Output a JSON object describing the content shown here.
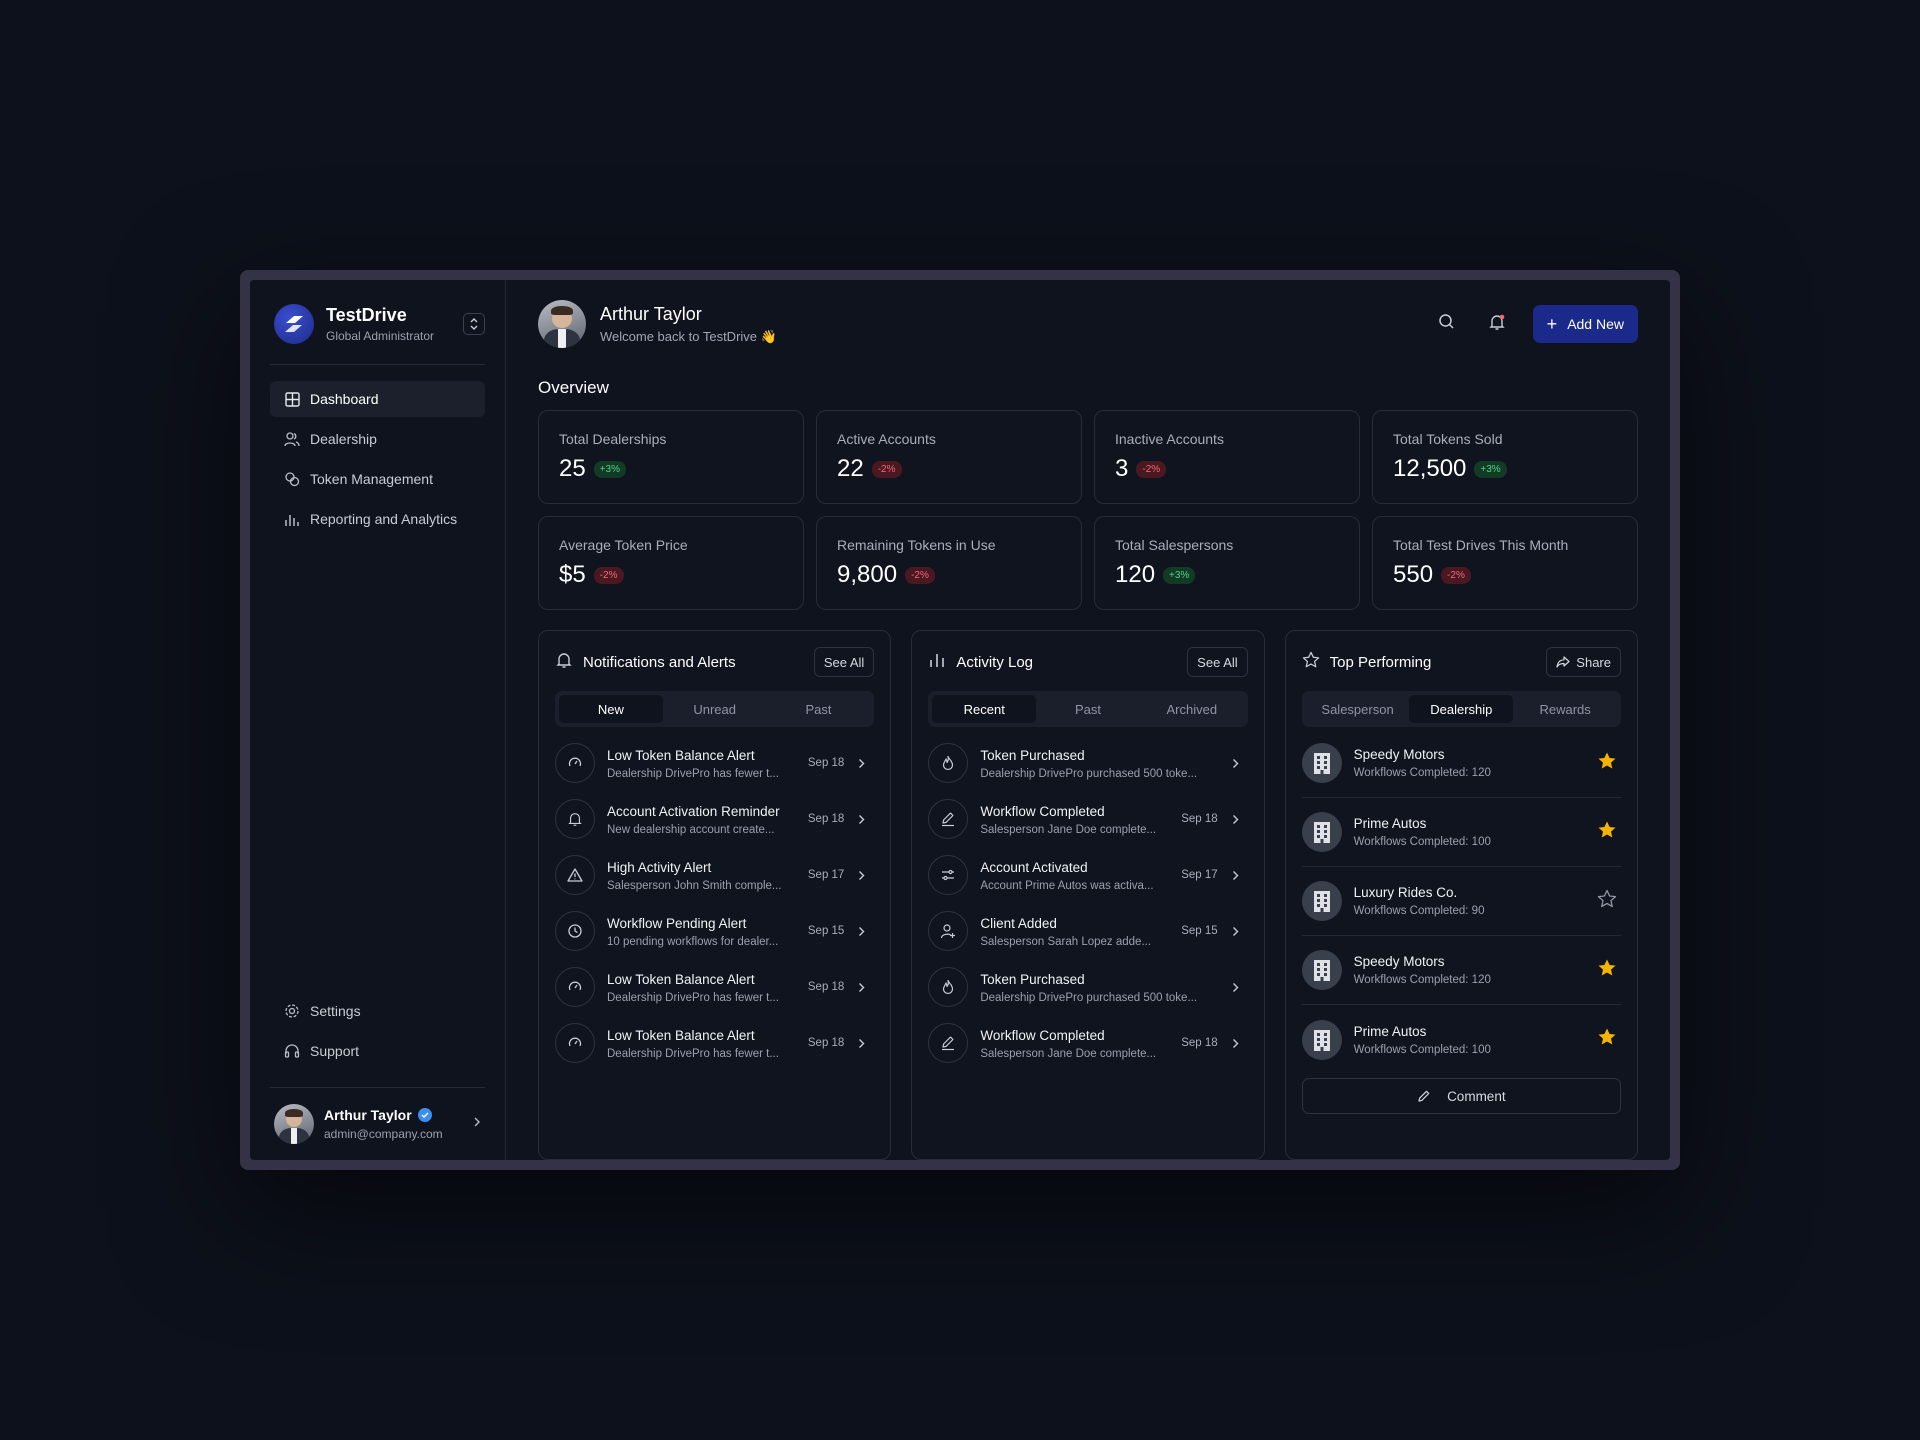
{
  "brand": {
    "name": "TestDrive",
    "role": "Global Administrator"
  },
  "nav": {
    "items": [
      {
        "label": "Dashboard",
        "icon": "grid-icon",
        "active": true
      },
      {
        "label": "Dealership",
        "icon": "users-icon"
      },
      {
        "label": "Token Management",
        "icon": "coins-icon"
      },
      {
        "label": "Reporting and Analytics",
        "icon": "bar-chart-icon"
      }
    ],
    "bottom": [
      {
        "label": "Settings",
        "icon": "gear-icon"
      },
      {
        "label": "Support",
        "icon": "headphones-icon"
      }
    ]
  },
  "user": {
    "name": "Arthur Taylor",
    "email": "admin@company.com"
  },
  "header": {
    "name": "Arthur Taylor",
    "welcome": "Welcome back to TestDrive 👋",
    "add_new": "Add New"
  },
  "overview": {
    "title": "Overview",
    "stats": [
      {
        "label": "Total Dealerships",
        "value": "25",
        "change": "+3%",
        "trend": "up"
      },
      {
        "label": "Active Accounts",
        "value": "22",
        "change": "-2%",
        "trend": "down"
      },
      {
        "label": "Inactive Accounts",
        "value": "3",
        "change": "-2%",
        "trend": "down"
      },
      {
        "label": "Total Tokens Sold",
        "value": "12,500",
        "change": "+3%",
        "trend": "up"
      },
      {
        "label": "Average Token Price",
        "value": "$5",
        "change": "-2%",
        "trend": "down"
      },
      {
        "label": "Remaining Tokens in Use",
        "value": "9,800",
        "change": "-2%",
        "trend": "down"
      },
      {
        "label": "Total Salespersons",
        "value": "120",
        "change": "+3%",
        "trend": "up"
      },
      {
        "label": "Total Test Drives This Month",
        "value": "550",
        "change": "-2%",
        "trend": "down"
      }
    ]
  },
  "notifications": {
    "title": "Notifications and Alerts",
    "see_all": "See All",
    "tabs": [
      "New",
      "Unread",
      "Past"
    ],
    "items": [
      {
        "icon": "gauge-icon",
        "title": "Low Token Balance Alert",
        "sub": "Dealership DrivePro has fewer t...",
        "date": "Sep 18"
      },
      {
        "icon": "bell-icon",
        "title": "Account Activation Reminder",
        "sub": "New dealership account create...",
        "date": "Sep 18"
      },
      {
        "icon": "warning-icon",
        "title": "High Activity Alert",
        "sub": "Salesperson John Smith comple...",
        "date": "Sep 17"
      },
      {
        "icon": "clock-icon",
        "title": "Workflow Pending Alert",
        "sub": "10 pending workflows for dealer...",
        "date": "Sep 15"
      },
      {
        "icon": "gauge-icon",
        "title": "Low Token Balance Alert",
        "sub": "Dealership DrivePro has fewer t...",
        "date": "Sep 18"
      },
      {
        "icon": "gauge-icon",
        "title": "Low Token Balance Alert",
        "sub": "Dealership DrivePro has fewer t...",
        "date": "Sep 18"
      }
    ]
  },
  "activity": {
    "title": "Activity Log",
    "see_all": "See All",
    "tabs": [
      "Recent",
      "Past",
      "Archived"
    ],
    "items": [
      {
        "icon": "flame-icon",
        "title": "Token Purchased",
        "sub": "Dealership DrivePro purchased 500 toke...",
        "date": ""
      },
      {
        "icon": "pen-icon",
        "title": "Workflow Completed",
        "sub": "Salesperson Jane Doe complete...",
        "date": "Sep 18"
      },
      {
        "icon": "toggles-icon",
        "title": "Account Activated",
        "sub": "Account Prime Autos was activa...",
        "date": "Sep 17"
      },
      {
        "icon": "user-plus-icon",
        "title": "Client Added",
        "sub": "Salesperson Sarah Lopez adde...",
        "date": "Sep 15"
      },
      {
        "icon": "flame-icon",
        "title": "Token Purchased",
        "sub": "Dealership DrivePro purchased 500 toke...",
        "date": ""
      },
      {
        "icon": "pen-icon",
        "title": "Workflow Completed",
        "sub": "Salesperson Jane Doe complete...",
        "date": "Sep 18"
      }
    ]
  },
  "top": {
    "title": "Top Performing",
    "share": "Share",
    "tabs": [
      "Salesperson",
      "Dealership",
      "Rewards"
    ],
    "items": [
      {
        "name": "Speedy Motors",
        "sub": "Workflows Completed: 120",
        "starred": true
      },
      {
        "name": "Prime Autos",
        "sub": "Workflows Completed: 100",
        "starred": true
      },
      {
        "name": "Luxury Rides Co.",
        "sub": "Workflows Completed: 90",
        "starred": false
      },
      {
        "name": "Speedy Motors",
        "sub": "Workflows Completed: 120",
        "starred": true
      },
      {
        "name": "Prime Autos",
        "sub": "Workflows Completed: 100",
        "starred": true
      }
    ],
    "comment": "Comment"
  },
  "colors": {
    "accent": "#1b2a8a",
    "star": "#f5b400",
    "up": "#4ed58a",
    "down": "#f06a78"
  }
}
